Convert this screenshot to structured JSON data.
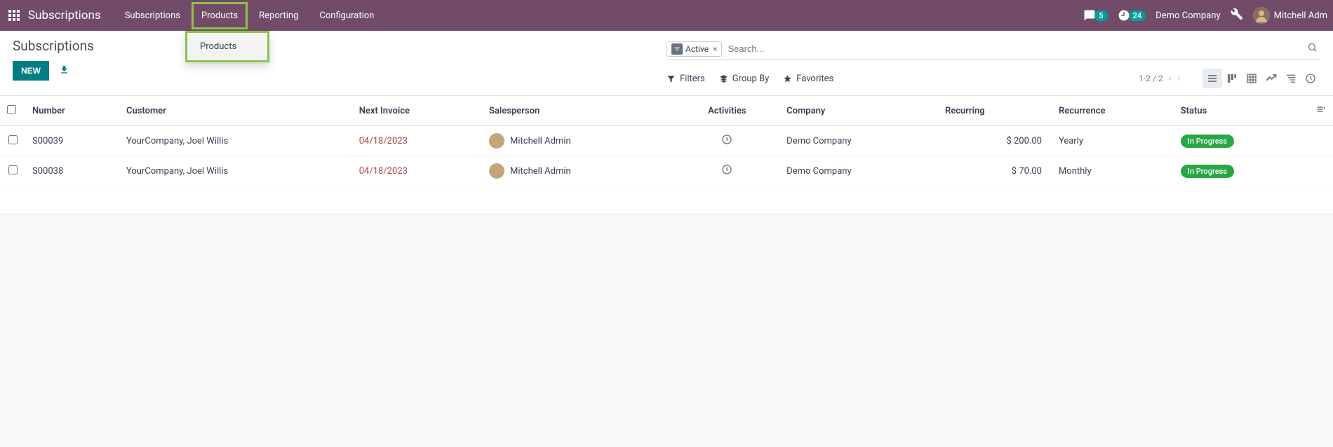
{
  "topbar": {
    "brand": "Subscriptions",
    "nav": [
      "Subscriptions",
      "Products",
      "Reporting",
      "Configuration"
    ],
    "messages_count": "5",
    "activities_count": "24",
    "company": "Demo Company",
    "user": "Mitchell Adm"
  },
  "dropdown": {
    "item": "Products"
  },
  "control": {
    "title": "Subscriptions",
    "new_btn": "NEW",
    "filter_chip": "Active",
    "search_placeholder": "Search...",
    "filters": "Filters",
    "groupby": "Group By",
    "favorites": "Favorites",
    "pager": "1-2 / 2"
  },
  "table": {
    "headers": {
      "number": "Number",
      "customer": "Customer",
      "next_invoice": "Next Invoice",
      "salesperson": "Salesperson",
      "activities": "Activities",
      "company": "Company",
      "recurring": "Recurring",
      "recurrence": "Recurrence",
      "status": "Status"
    },
    "rows": [
      {
        "number": "S00039",
        "customer": "YourCompany, Joel Willis",
        "next_invoice": "04/18/2023",
        "salesperson": "Mitchell Admin",
        "company": "Demo Company",
        "recurring": "$ 200.00",
        "recurrence": "Yearly",
        "status": "In Progress"
      },
      {
        "number": "S00038",
        "customer": "YourCompany, Joel Willis",
        "next_invoice": "04/18/2023",
        "salesperson": "Mitchell Admin",
        "company": "Demo Company",
        "recurring": "$ 70.00",
        "recurrence": "Monthly",
        "status": "In Progress"
      }
    ]
  }
}
